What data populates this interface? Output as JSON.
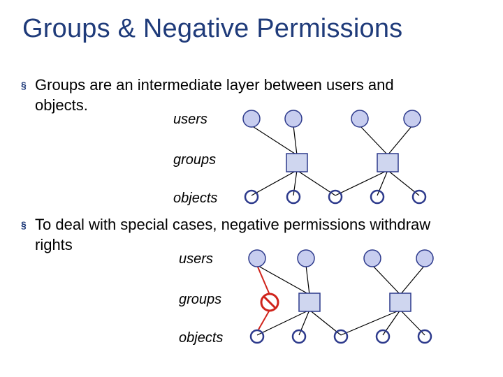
{
  "title": "Groups & Negative Permissions",
  "bullets": [
    "Groups are an intermediate layer between users and objects.",
    "To deal with special cases, negative permissions withdraw rights"
  ],
  "labels": {
    "users": "users",
    "groups": "groups",
    "objects": "objects"
  }
}
